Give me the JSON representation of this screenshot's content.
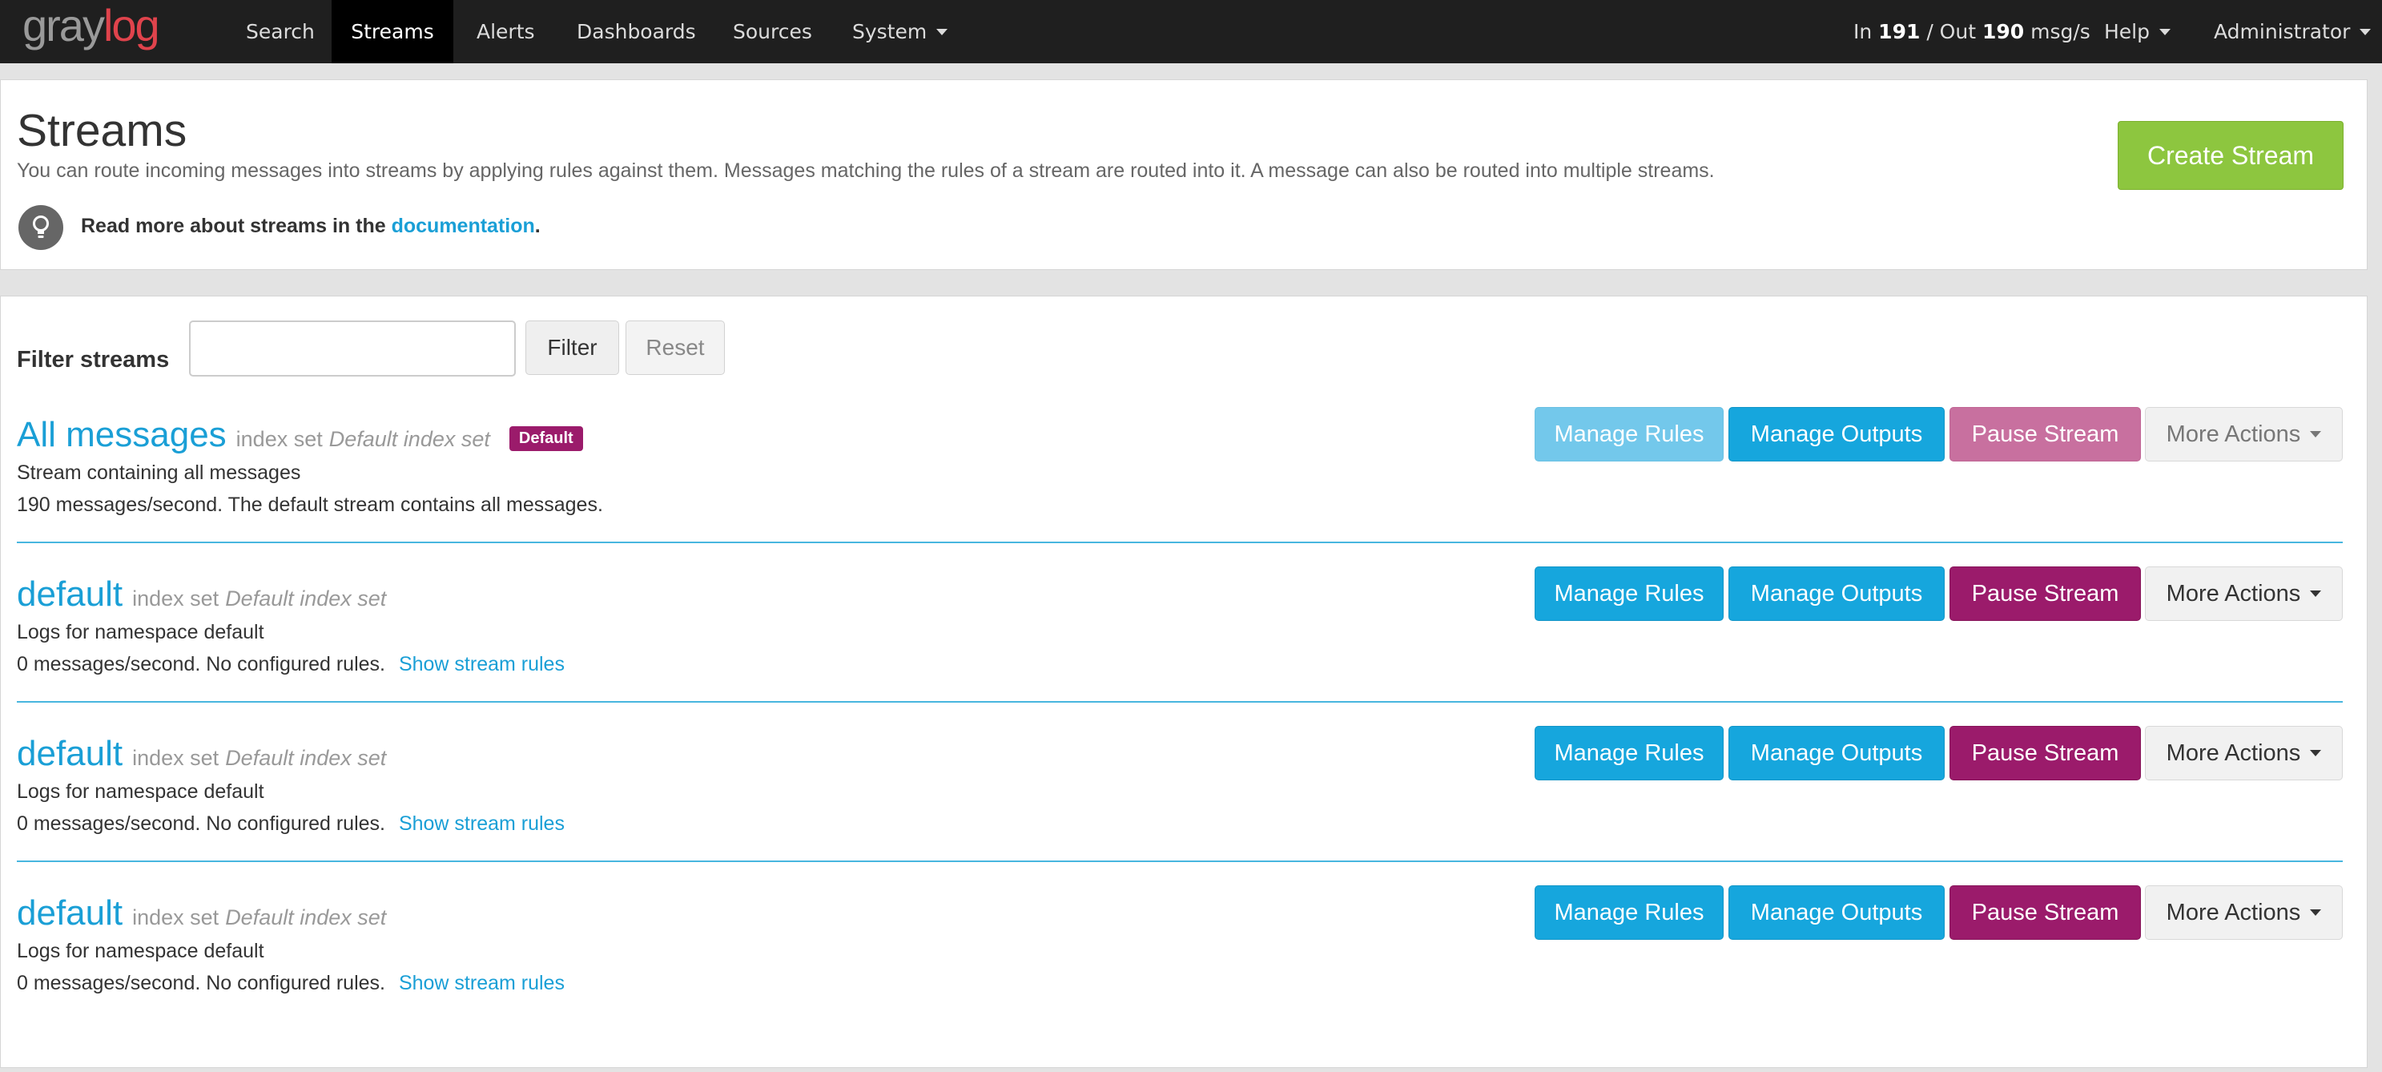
{
  "brand": {
    "logo_gray": "gray",
    "logo_red": "log"
  },
  "nav": {
    "search": "Search",
    "streams": "Streams",
    "alerts": "Alerts",
    "dashboards": "Dashboards",
    "sources": "Sources",
    "system": "System",
    "throughput_in_label": "In",
    "throughput_in": "191",
    "throughput_sep": "/ Out",
    "throughput_out": "190",
    "throughput_unit": "msg/s",
    "help": "Help",
    "user": "Administrator"
  },
  "header": {
    "title": "Streams",
    "description": "You can route incoming messages into streams by applying rules against them. Messages matching the rules of a stream are routed into it. A message can also be routed into multiple streams.",
    "docs_prefix": "Read more about streams in the",
    "docs_link": "documentation",
    "docs_suffix": ".",
    "create_button": "Create Stream"
  },
  "filter": {
    "label": "Filter streams",
    "value": "",
    "placeholder": "",
    "filter_button": "Filter",
    "reset_button": "Reset"
  },
  "buttons": {
    "manage_rules": "Manage Rules",
    "manage_outputs": "Manage Outputs",
    "pause_stream": "Pause Stream",
    "more_actions": "More Actions"
  },
  "streams": [
    {
      "title": "All messages",
      "index_label": "index set",
      "index_name": "Default index set",
      "badge": "Default",
      "description": "Stream containing all messages",
      "stats": "190 messages/second. The default stream contains all messages.",
      "rules_link": ""
    },
    {
      "title": "default",
      "index_label": "index set",
      "index_name": "Default index set",
      "description": "Logs for namespace default",
      "stats": "0 messages/second. No configured rules.",
      "rules_link": "Show stream rules"
    },
    {
      "title": "default",
      "index_label": "index set",
      "index_name": "Default index set",
      "description": "Logs for namespace default",
      "stats": "0 messages/second. No configured rules.",
      "rules_link": "Show stream rules"
    },
    {
      "title": "default",
      "index_label": "index set",
      "index_name": "Default index set",
      "description": "Logs for namespace default",
      "stats": "0 messages/second. No configured rules.",
      "rules_link": "Show stream rules"
    }
  ],
  "colors": {
    "navbar": "#1f1f1f",
    "link_blue": "#1a9fd6",
    "button_blue": "#16a6dd",
    "button_magenta": "#9b1b6b",
    "create_green": "#8dc63f",
    "logo_red": "#e0434c"
  }
}
